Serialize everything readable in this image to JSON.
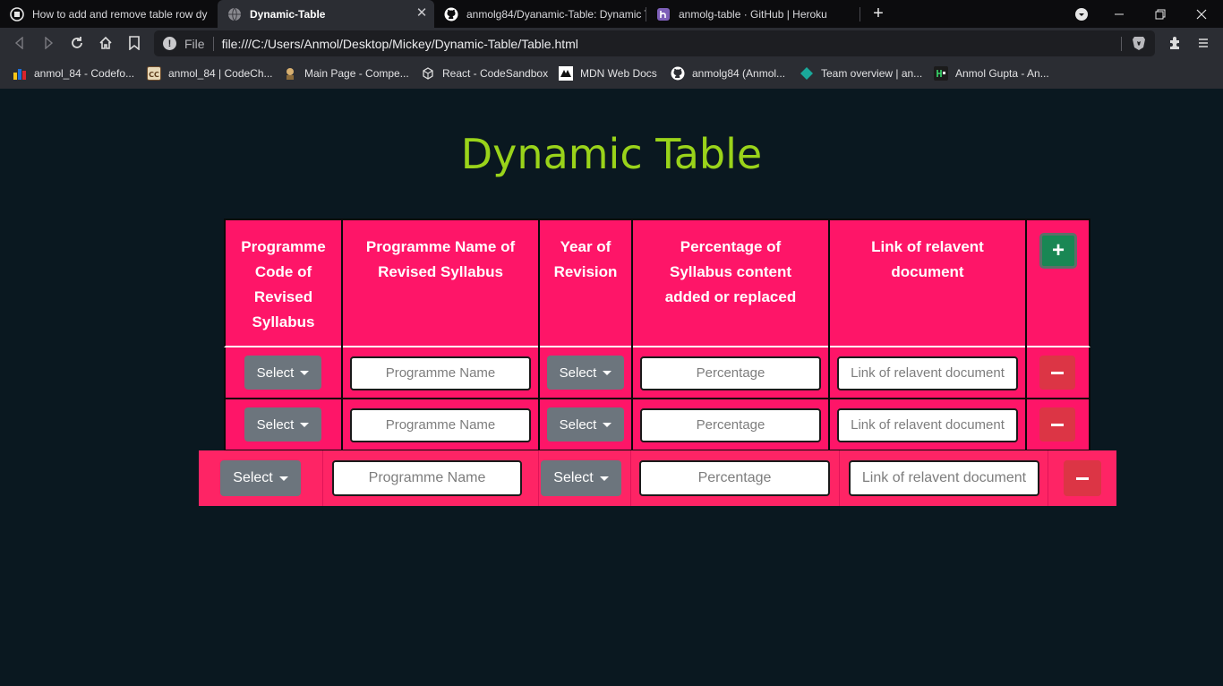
{
  "browser": {
    "tabs": [
      {
        "title": "How to add and remove table row dy",
        "icon": "codeforces-icon"
      },
      {
        "title": "Dynamic-Table",
        "icon": "globe-icon",
        "active": true
      },
      {
        "title": "anmolg84/Dyanamic-Table: Dynamic T",
        "icon": "github-icon"
      },
      {
        "title": "anmolg-table · GitHub | Heroku",
        "icon": "heroku-icon"
      }
    ],
    "new_tab": "+",
    "file_label": "File",
    "url": "file:///C:/Users/Anmol/Desktop/Mickey/Dynamic-Table/Table.html"
  },
  "bookmarks": [
    {
      "label": "anmol_84 - Codefo...",
      "icon": "codeforces-icon"
    },
    {
      "label": "anmol_84 | CodeCh...",
      "icon": "codechef-icon"
    },
    {
      "label": "Main Page - Compe...",
      "icon": "wiki-icon"
    },
    {
      "label": "React - CodeSandbox",
      "icon": "codesandbox-icon"
    },
    {
      "label": "MDN Web Docs",
      "icon": "mdn-icon"
    },
    {
      "label": "anmolg84 (Anmol...",
      "icon": "github-icon"
    },
    {
      "label": "Team overview | an...",
      "icon": "diamond-icon"
    },
    {
      "label": "Anmol Gupta - An...",
      "icon": "hackerrank-icon"
    }
  ],
  "page": {
    "heading": "Dynamic Table",
    "headers": [
      "Programme Code of Revised Syllabus",
      "Programme Name of Revised Syllabus",
      "Year of Revision",
      "Percentage of Syllabus content added or replaced",
      "Link of relavent document"
    ],
    "add_button": "+",
    "select_label": "Select",
    "placeholders": {
      "programme_name": "Programme Name",
      "percentage": "Percentage",
      "link": "Link of relavent document"
    }
  },
  "colors": {
    "heading": "#9ad31a",
    "table_bg": "#fe1568",
    "select_btn": "#6c757d",
    "remove_btn": "#dc3545",
    "add_btn": "#198754",
    "page_bg": "#0a1820"
  }
}
